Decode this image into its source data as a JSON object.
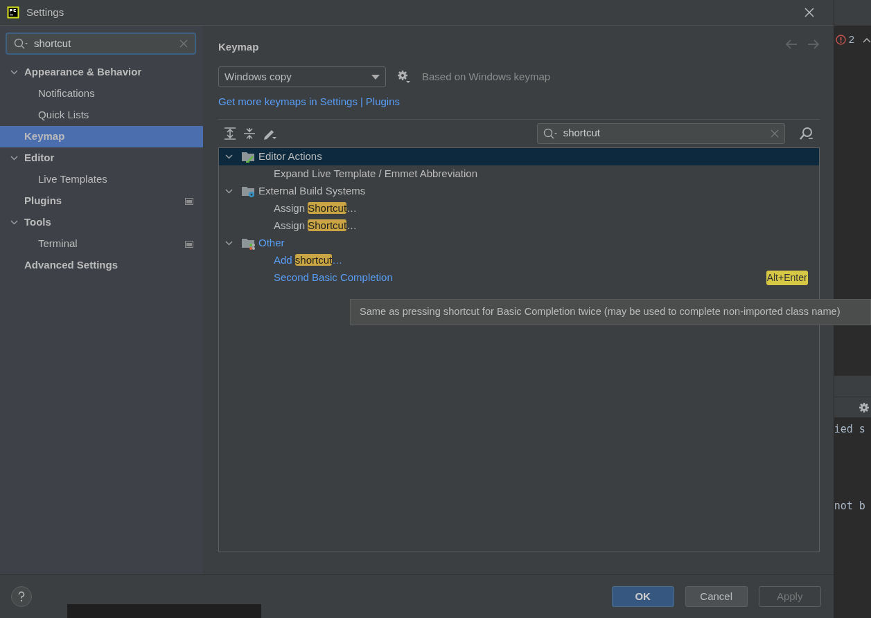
{
  "window": {
    "title": "Settings"
  },
  "sidebar": {
    "search": {
      "value": "shortcut"
    },
    "items": [
      {
        "label": "Appearance & Behavior",
        "expanded": true,
        "selected": false,
        "marked": false,
        "children": [
          {
            "label": "Notifications",
            "selected": false,
            "marked": false
          },
          {
            "label": "Quick Lists",
            "selected": false,
            "marked": false
          }
        ]
      },
      {
        "label": "Keymap",
        "selected": true,
        "marked": false
      },
      {
        "label": "Editor",
        "expanded": true,
        "selected": false,
        "marked": false,
        "children": [
          {
            "label": "Live Templates",
            "selected": false,
            "marked": false
          }
        ]
      },
      {
        "label": "Plugins",
        "selected": false,
        "marked": true
      },
      {
        "label": "Tools",
        "expanded": true,
        "selected": false,
        "marked": false,
        "children": [
          {
            "label": "Terminal",
            "selected": false,
            "marked": true
          }
        ]
      },
      {
        "label": "Advanced Settings",
        "selected": false,
        "marked": false
      }
    ]
  },
  "main": {
    "title": "Keymap",
    "keymap_select": {
      "value": "Windows copy"
    },
    "based_on": "Based on Windows keymap",
    "more_keymaps": {
      "text": "Get more keymaps in Settings",
      "separator": "|",
      "link": "Plugins"
    },
    "search": {
      "value": "shortcut"
    },
    "tree": [
      {
        "kind": "editor",
        "label": "Editor Actions",
        "expanded": true,
        "selected": true,
        "modified": false,
        "children": [
          {
            "segments": [
              {
                "text": "Expand Live Template / Emmet Abbreviation",
                "match": false
              }
            ],
            "modified": false
          }
        ]
      },
      {
        "kind": "build",
        "label": "External Build Systems",
        "expanded": true,
        "selected": false,
        "modified": false,
        "children": [
          {
            "segments": [
              {
                "text": "Assign ",
                "match": false
              },
              {
                "text": "Shortcut",
                "match": true
              },
              {
                "text": "…",
                "match": false
              }
            ],
            "modified": false
          },
          {
            "segments": [
              {
                "text": "Assign ",
                "match": false
              },
              {
                "text": "Shortcut",
                "match": true
              },
              {
                "text": "…",
                "match": false
              }
            ],
            "modified": false
          }
        ]
      },
      {
        "kind": "other",
        "label": "Other",
        "expanded": true,
        "selected": false,
        "modified": true,
        "children": [
          {
            "segments": [
              {
                "text": "Add ",
                "match": false
              },
              {
                "text": "shortcut",
                "match": true
              },
              {
                "text": "…",
                "match": false
              }
            ],
            "modified": true
          },
          {
            "segments": [
              {
                "text": "Second Basic Completion",
                "match": false
              }
            ],
            "modified": true,
            "shortcut": "Alt+Enter"
          }
        ]
      }
    ],
    "tooltip": "Same as pressing shortcut for Basic Completion twice (may be used to complete non-imported class name)"
  },
  "buttons": [
    {
      "label": "OK",
      "kind": "default",
      "disabled": false
    },
    {
      "label": "Cancel",
      "kind": "normal",
      "disabled": false
    },
    {
      "label": "Apply",
      "kind": "normal",
      "disabled": true
    }
  ],
  "editor_behind": {
    "error_count": "2",
    "lines": [
      "ied s",
      "not b"
    ]
  }
}
